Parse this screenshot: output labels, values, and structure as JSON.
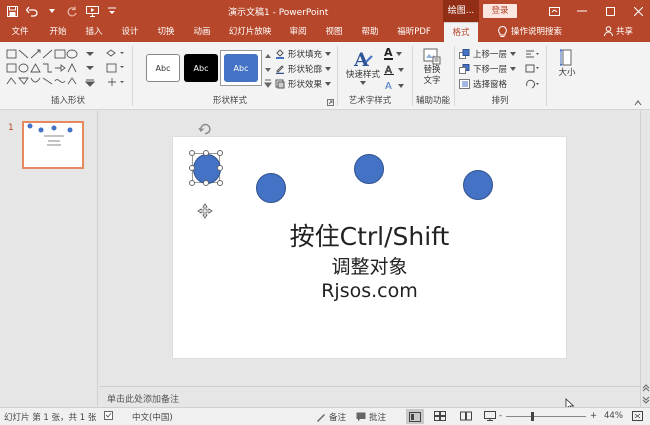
{
  "titlebar": {
    "doc_title": "演示文稿1 - PowerPoint",
    "context_label": "绘图...",
    "login_label": "登录"
  },
  "tabs": [
    {
      "label": "文件"
    },
    {
      "label": "开始"
    },
    {
      "label": "插入"
    },
    {
      "label": "设计"
    },
    {
      "label": "切换"
    },
    {
      "label": "动画"
    },
    {
      "label": "幻灯片放映"
    },
    {
      "label": "审阅"
    },
    {
      "label": "视图"
    },
    {
      "label": "帮助"
    },
    {
      "label": "福昕PDF"
    },
    {
      "label": "格式"
    }
  ],
  "tell_me": "操作说明搜索",
  "share": "共享",
  "ribbon": {
    "insert_shapes_label": "插入形状",
    "shape_styles_label": "形状样式",
    "style_sample": "Abc",
    "fill_label": "形状填充",
    "outline_label": "形状轮廓",
    "effects_label": "形状效果",
    "quick_styles_label": "快速样式",
    "wordart_label": "艺术字样式",
    "alt_text_line1": "替换",
    "alt_text_line2": "文字",
    "accessibility_label": "辅助功能",
    "bring_forward": "上移一层",
    "send_backward": "下移一层",
    "selection_pane": "选择窗格",
    "arrange_label": "排列",
    "size_label": "大小",
    "wordart_letter": "A"
  },
  "leftpanel": {
    "slide_number": "1"
  },
  "slide": {
    "title": "按住Ctrl/Shift",
    "subtitle": "调整对象",
    "url": "Rjsos.com"
  },
  "notes_placeholder": "单击此处添加备注",
  "statusbar": {
    "slide_info": "幻灯片 第 1 张，共 1 张",
    "language": "中文(中国)",
    "notes_btn": "备注",
    "comments_btn": "批注",
    "zoom_minus": "-",
    "zoom_plus": "+",
    "zoom_level": "44%"
  },
  "colors": {
    "accent": "#b7472a",
    "shape_fill": "#4472c4"
  }
}
